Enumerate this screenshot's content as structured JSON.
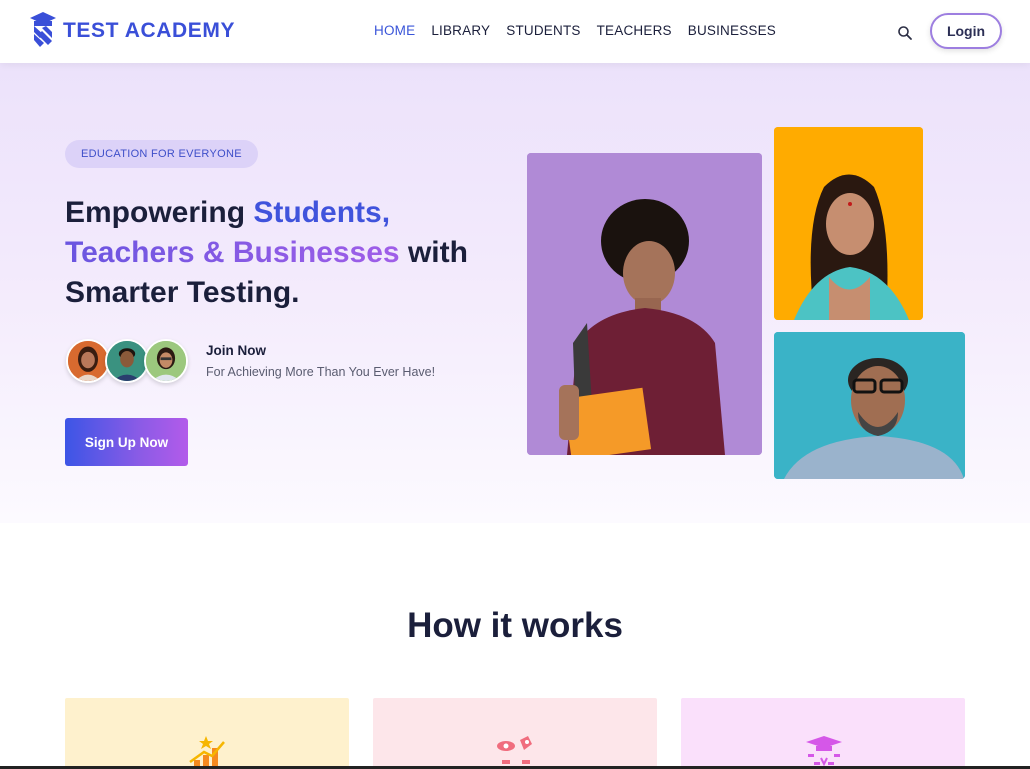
{
  "header": {
    "brand": "TEST ACADEMY",
    "nav": [
      "HOME",
      "LIBRARY",
      "STUDENTS",
      "TEACHERS",
      "BUSINESSES"
    ],
    "active_nav": "HOME",
    "login_label": "Login",
    "icons": {
      "search": "search-icon",
      "logo": "graduation-cap-logo-icon"
    }
  },
  "hero": {
    "badge": "EDUCATION FOR EVERYONE",
    "headline": {
      "part1": "Empowering ",
      "highlight1": "Students,",
      "highlight2": "Teachers & Businesses",
      "part2": " with",
      "part3": "Smarter Testing."
    },
    "join_title": "Join Now",
    "join_subtitle": "For Achieving More Than You Ever Have!",
    "signup_label": "Sign Up Now"
  },
  "how_it_works": {
    "title": "How it works",
    "cards": [
      {
        "icon": "growth-chart-icon",
        "color": "#fef1cd"
      },
      {
        "icon": "eye-tools-icon",
        "color": "#fde6ea"
      },
      {
        "icon": "graduation-cap-icon",
        "color": "#fae0fb"
      }
    ]
  },
  "colors": {
    "brand": "#3a4fd8",
    "accent_blue": "#4053dc",
    "accent_purple": "#8a5be6",
    "nav_active": "#3a55d9"
  }
}
